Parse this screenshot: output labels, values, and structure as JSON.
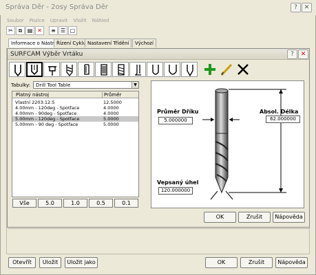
{
  "outer": {
    "title": "Správa Děr - 2osy Správa Děr",
    "menu": [
      "Soubor",
      "Pozice",
      "Upravit",
      "Vložit",
      "Náhled"
    ],
    "tabs": [
      "Informace o Nástroji",
      "Řízení Cyklu",
      "Nastavení Třídění",
      "Výchozí"
    ],
    "buttons": {
      "open": "Otevřít",
      "save": "Uložit",
      "save_as": "Uložit jako",
      "ok": "OK",
      "cancel": "Zrušit",
      "help": "Nápověda"
    },
    "title_buttons": {
      "help": "?",
      "close": "✕"
    }
  },
  "dialog": {
    "title": "SURFCAM Výběr Vrtáku",
    "title_buttons": {
      "help": "?",
      "close": "✕"
    },
    "tables_label": "Tabulky:",
    "tables_value": "Drill Tool Table",
    "list": {
      "col_tool": "Platný nástroj",
      "col_diameter": "Průměr",
      "rows": [
        {
          "name": "Vlastní 2203:12:5",
          "diameter": "12.5000",
          "selected": false
        },
        {
          "name": "4.00mm - 120deg - Spotface",
          "diameter": "4.0000",
          "selected": false
        },
        {
          "name": "4.00mm -  90deg - Spotface",
          "diameter": "4.0000",
          "selected": false
        },
        {
          "name": "5.00mm - 120deg - Spotface",
          "diameter": "5.0000",
          "selected": true
        },
        {
          "name": "5.00mm -  90 deg - Spotface",
          "diameter": "5.0000",
          "selected": false
        }
      ]
    },
    "filters": [
      "Vše",
      "5.0",
      "1.0",
      "0.5",
      "0.1"
    ],
    "diagram": {
      "shank_label": "Průměr Dříku",
      "shank_value": "5.000000",
      "length_label": "Absol. Délka",
      "length_value": "62.000000",
      "angle_label": "Vepsaný úhel",
      "angle_value": "120.000000"
    },
    "buttons": {
      "ok": "OK",
      "cancel": "Zrušit",
      "help": "Nápověda"
    }
  }
}
